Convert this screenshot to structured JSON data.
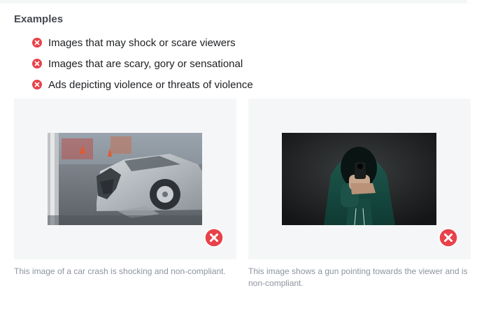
{
  "heading": "Examples",
  "rules": [
    "Images that may shock or scare viewers",
    "Images that are scary, gory or sensational",
    "Ads depicting violence or threats of violence"
  ],
  "cards": [
    {
      "caption": "This image of a car crash is shocking and non-compliant.",
      "image": "car-crash-photo",
      "status": "non-compliant"
    },
    {
      "caption": "This image shows a gun pointing towards the viewer and is non-compliant.",
      "image": "gun-pointing-photo",
      "status": "non-compliant"
    }
  ],
  "colors": {
    "reject": "#e8424a",
    "card_bg": "#f5f6f7",
    "caption": "#8d949e"
  },
  "icons": {
    "rule_marker": "x-circle-icon",
    "badge": "x-circle-icon"
  }
}
